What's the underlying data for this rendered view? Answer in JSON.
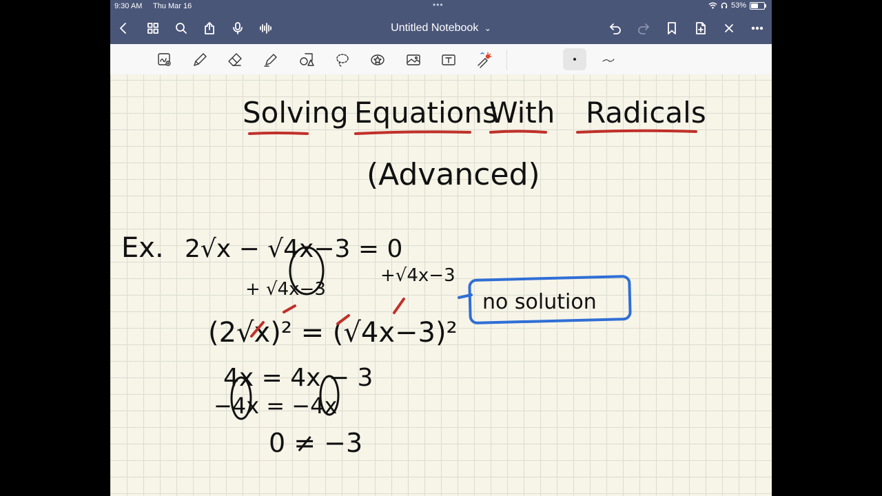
{
  "status": {
    "time": "9:30 AM",
    "date": "Thu Mar 16",
    "battery": "53%"
  },
  "navbar": {
    "title": "Untitled Notebook",
    "chevron": "⌄"
  },
  "icons": {
    "back": "chevron-left-icon",
    "grid": "grid-icon",
    "search": "search-icon",
    "share": "share-icon",
    "mic": "microphone-icon",
    "audio": "audio-waveform-icon",
    "undo": "undo-icon",
    "redo": "redo-icon",
    "bookmark": "bookmark-icon",
    "add_page": "add-page-icon",
    "close": "close-icon",
    "more": "more-icon"
  },
  "tools": [
    "zoom-window",
    "pen",
    "eraser",
    "highlighter",
    "shapes",
    "lasso",
    "elements",
    "image",
    "text",
    "laser-pointer"
  ],
  "colors": {
    "bar": "#4a5678",
    "paper": "#f7f4e8",
    "grid": "#dcdcd0",
    "ink_black": "#111111",
    "ink_red": "#c0302a",
    "ink_blue": "#2f6fd6"
  },
  "note": {
    "title_words": [
      "Solving",
      "Equations",
      "With",
      "Radicals"
    ],
    "subtitle": "(Advanced)",
    "example_label": "Ex.",
    "lines": [
      "2√x − √4x−3 = 0",
      "+√4x−3",
      "+ √4x−3",
      "(2√x)² = (√4x−3)²",
      "4x = 4x − 3",
      "−4x   = −4x",
      "0 ≠ −3"
    ],
    "boxed": "no solution"
  }
}
